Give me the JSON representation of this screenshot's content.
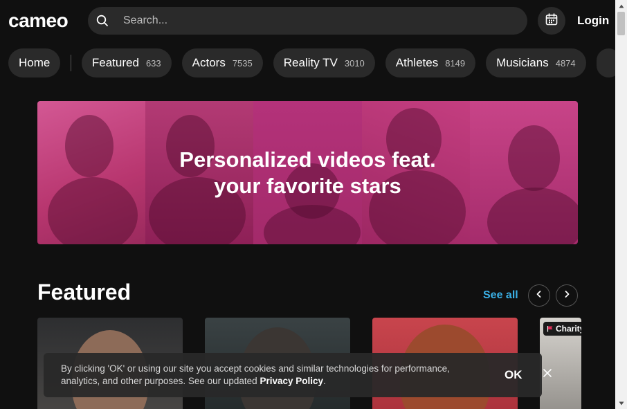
{
  "header": {
    "logo": "cameo",
    "search_placeholder": "Search...",
    "login_label": "Login"
  },
  "categories": [
    {
      "label": "Home",
      "count": ""
    },
    {
      "label": "Featured",
      "count": "633"
    },
    {
      "label": "Actors",
      "count": "7535"
    },
    {
      "label": "Reality TV",
      "count": "3010"
    },
    {
      "label": "Athletes",
      "count": "8149"
    },
    {
      "label": "Musicians",
      "count": "4874"
    }
  ],
  "banner": {
    "line1": "Personalized videos feat.",
    "line2": "your favorite stars"
  },
  "featured": {
    "title": "Featured",
    "see_all": "See all",
    "cards": [
      {
        "badge": ""
      },
      {
        "badge": ""
      },
      {
        "badge": ""
      },
      {
        "badge": "Charity"
      }
    ]
  },
  "cookie": {
    "text": "By clicking 'OK' or using our site you accept cookies and similar technologies for performance, analytics, and other purposes. See our updated",
    "link": "Privacy Policy",
    "suffix": ".",
    "ok_label": "OK"
  },
  "colors": {
    "background": "#101010",
    "pill_bg": "#2a2a2a",
    "accent_link": "#3ab0e6",
    "banner_pink": "#b8366f"
  },
  "icons": {
    "search": "search-icon",
    "calendar": "calendar-icon",
    "prev": "chevron-left-icon",
    "next": "chevron-right-icon",
    "close": "close-icon",
    "flag": "flag-icon"
  }
}
